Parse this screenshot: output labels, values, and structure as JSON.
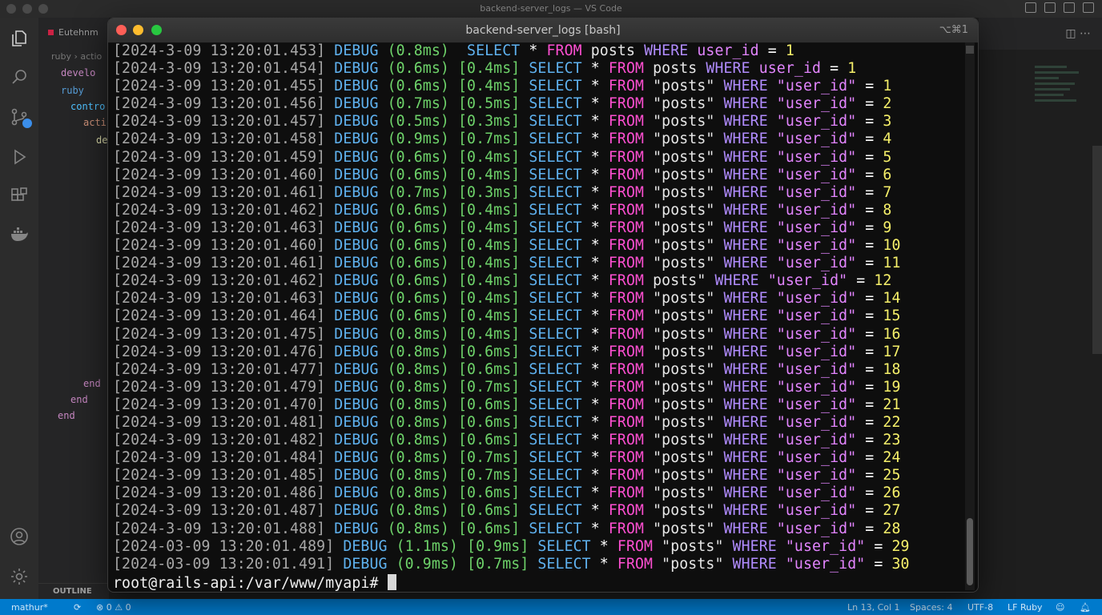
{
  "vscode": {
    "window_title": "backend-server_logs — VS Code",
    "editor_tab": "Eutehnm",
    "breadcrumb": "ruby › actio",
    "code_lines": [
      {
        "text": "develo",
        "color": "#c586c0"
      },
      {
        "text": "ruby",
        "color": "#569cd6"
      },
      {
        "text": "contro",
        "color": "#4fc1ff"
      },
      {
        "text": "acti",
        "color": "#ce9178"
      },
      {
        "text": "def",
        "color": "#dcdcaa"
      },
      {
        "text": "end",
        "color": "#c586c0"
      },
      {
        "text": "end",
        "color": "#c586c0"
      },
      {
        "text": "end",
        "color": "#c586c0"
      }
    ],
    "outline_label": "OUTLINE",
    "status": {
      "branch": "mathur*",
      "errors": "⊗ 0 ⚠ 0",
      "position": "Ln 13, Col 1",
      "spaces": "Spaces: 4",
      "encoding": "UTF-8",
      "language": "LF Ruby"
    }
  },
  "terminal": {
    "title": "backend-server_logs [bash]",
    "shortcut": "⌥⌘1",
    "prompt": "root@rails-api:/var/www/myapi#",
    "colors": {
      "timestamp": "#a8a8a8",
      "debug": "#5fb2f0",
      "duration": "#6ed36a",
      "from": "#ff4fd2",
      "where": "#b18cff",
      "number": "#f6f06a"
    },
    "lines": [
      {
        "ts": "[2024-3-09 13:20:01.453]",
        "lvl": "DEBUG",
        "dur": "(0.8ms) ",
        "sel": " SELECT",
        "op": " * ",
        "from": "FROM",
        "tbl": " posts ",
        "where": "WHERE",
        "col": " user_id",
        "eq": " = ",
        "val": "1"
      },
      {
        "ts": "[2024-3-09 13:20:01.454]",
        "lvl": "DEBUG",
        "dur": "(0.6ms) [0.4ms]",
        "sel": " SELECT",
        "op": " * ",
        "from": "FROM",
        "tbl": " posts ",
        "where": "WHERE",
        "col": " user_id",
        "eq": " = ",
        "val": "1"
      },
      {
        "ts": "[2024-3-09 13:20:01.455]",
        "lvl": "DEBUG",
        "dur": "(0.6ms) [0.4ms]",
        "sel": " SELECT",
        "op": " * ",
        "from": "FROM",
        "tbl": " \"posts\" ",
        "where": "WHERE",
        "col": " \"user_id\"",
        "eq": " = ",
        "val": "1"
      },
      {
        "ts": "[2024-3-09 13:20:01.456]",
        "lvl": "DEBUG",
        "dur": "(0.7ms) [0.5ms]",
        "sel": " SELECT",
        "op": " * ",
        "from": "FROM",
        "tbl": " \"posts\" ",
        "where": "WHERE",
        "col": " \"user_id\"",
        "eq": " = ",
        "val": "2"
      },
      {
        "ts": "[2024-3-09 13:20:01.457]",
        "lvl": "DEBUG",
        "dur": "(0.5ms) [0.3ms]",
        "sel": " SELECT",
        "op": " * ",
        "from": "FROM",
        "tbl": " \"posts\" ",
        "where": "WHERE",
        "col": " \"user_id\"",
        "eq": " = ",
        "val": "3"
      },
      {
        "ts": "[2024-3-09 13:20:01.458]",
        "lvl": "DEBUG",
        "dur": "(0.9ms) [0.7ms]",
        "sel": " SELECT",
        "op": " * ",
        "from": "FROM",
        "tbl": " \"posts\" ",
        "where": "WHERE",
        "col": " \"user_id\"",
        "eq": " = ",
        "val": "4"
      },
      {
        "ts": "[2024-3-09 13:20:01.459]",
        "lvl": "DEBUG",
        "dur": "(0.6ms) [0.4ms]",
        "sel": " SELECT",
        "op": " * ",
        "from": "FROM",
        "tbl": " \"posts\" ",
        "where": "WHERE",
        "col": " \"user_id\"",
        "eq": " = ",
        "val": "5"
      },
      {
        "ts": "[2024-3-09 13:20:01.460]",
        "lvl": "DEBUG",
        "dur": "(0.6ms) [0.4ms]",
        "sel": " SELECT",
        "op": " * ",
        "from": "FROM",
        "tbl": " \"posts\" ",
        "where": "WHERE",
        "col": " \"user_id\"",
        "eq": " = ",
        "val": "6"
      },
      {
        "ts": "[2024-3-09 13:20:01.461]",
        "lvl": "DEBUG",
        "dur": "(0.7ms) [0.3ms]",
        "sel": " SELECT",
        "op": " * ",
        "from": "FROM",
        "tbl": " \"posts\" ",
        "where": "WHERE",
        "col": " \"user_id\"",
        "eq": " = ",
        "val": "7"
      },
      {
        "ts": "[2024-3-09 13:20:01.462]",
        "lvl": "DEBUG",
        "dur": "(0.6ms) [0.4ms]",
        "sel": " SELECT",
        "op": " * ",
        "from": "FROM",
        "tbl": " \"posts\" ",
        "where": "WHERE",
        "col": " \"user_id\"",
        "eq": " = ",
        "val": "8"
      },
      {
        "ts": "[2024-3-09 13:20:01.463]",
        "lvl": "DEBUG",
        "dur": "(0.6ms) [0.4ms]",
        "sel": " SELECT",
        "op": " * ",
        "from": "FROM",
        "tbl": " \"posts\" ",
        "where": "WHERE",
        "col": " \"user_id\"",
        "eq": " = ",
        "val": "9"
      },
      {
        "ts": "[2024-3-09 13:20:01.460]",
        "lvl": "DEBUG",
        "dur": "(0.6ms) [0.4ms]",
        "sel": " SELECT",
        "op": " * ",
        "from": "FROM",
        "tbl": " \"posts\" ",
        "where": "WHERE",
        "col": " \"user_id\"",
        "eq": " = ",
        "val": "10"
      },
      {
        "ts": "[2024-3-09 13:20:01.461]",
        "lvl": "DEBUG",
        "dur": "(0.6ms) [0.4ms]",
        "sel": " SELECT",
        "op": " * ",
        "from": "FROM",
        "tbl": " \"posts\" ",
        "where": "WHERE",
        "col": " \"user_id\"",
        "eq": " = ",
        "val": "11"
      },
      {
        "ts": "[2024-3-09 13:20:01.462]",
        "lvl": "DEBUG",
        "dur": "(0.6ms) [0.4ms]",
        "sel": " SELECT",
        "op": " * ",
        "from": "FROM",
        "tbl": " posts\" ",
        "where": "WHERE",
        "col": " \"user_id\"",
        "eq": " = ",
        "val": "12"
      },
      {
        "ts": "[2024-3-09 13:20:01.463]",
        "lvl": "DEBUG",
        "dur": "(0.6ms) [0.4ms]",
        "sel": " SELECT",
        "op": " * ",
        "from": "FROM",
        "tbl": " \"posts\" ",
        "where": "WHERE",
        "col": " \"user_id\"",
        "eq": " = ",
        "val": "14"
      },
      {
        "ts": "[2024-3-09 13:20:01.464]",
        "lvl": "DEBUG",
        "dur": "(0.6ms) [0.4ms]",
        "sel": " SELECT",
        "op": " * ",
        "from": "FROM",
        "tbl": " \"posts\" ",
        "where": "WHERE",
        "col": " \"user_id\"",
        "eq": " = ",
        "val": "15"
      },
      {
        "ts": "[2024-3-09 13:20:01.475]",
        "lvl": "DEBUG",
        "dur": "(0.8ms) [0.4ms]",
        "sel": " SELECT",
        "op": " * ",
        "from": "FROM",
        "tbl": " \"posts\" ",
        "where": "WHERE",
        "col": " \"user_id\"",
        "eq": " = ",
        "val": "16"
      },
      {
        "ts": "[2024-3-09 13:20:01.476]",
        "lvl": "DEBUG",
        "dur": "(0.8ms) [0.6ms]",
        "sel": " SELECT",
        "op": " * ",
        "from": "FROM",
        "tbl": " \"posts\" ",
        "where": "WHERE",
        "col": " \"user_id\"",
        "eq": " = ",
        "val": "17"
      },
      {
        "ts": "[2024-3-09 13:20:01.477]",
        "lvl": "DEBUG",
        "dur": "(0.8ms) [0.6ms]",
        "sel": " SELECT",
        "op": " * ",
        "from": "FROM",
        "tbl": " \"posts\" ",
        "where": "WHERE",
        "col": " \"user_id\"",
        "eq": " = ",
        "val": "18"
      },
      {
        "ts": "[2024-3-09 13:20:01.479]",
        "lvl": "DEBUG",
        "dur": "(0.8ms) [0.7ms]",
        "sel": " SELECT",
        "op": " * ",
        "from": "FROM",
        "tbl": " \"posts\" ",
        "where": "WHERE",
        "col": " \"user_id\"",
        "eq": " = ",
        "val": "19"
      },
      {
        "ts": "[2024-3-09 13:20:01.470]",
        "lvl": "DEBUG",
        "dur": "(0.8ms) [0.6ms]",
        "sel": " SELECT",
        "op": " * ",
        "from": "FROM",
        "tbl": " \"posts\" ",
        "where": "WHERE",
        "col": " \"user_id\"",
        "eq": " = ",
        "val": "21"
      },
      {
        "ts": "[2024-3-09 13:20:01.481]",
        "lvl": "DEBUG",
        "dur": "(0.8ms) [0.6ms]",
        "sel": " SELECT",
        "op": " * ",
        "from": "FROM",
        "tbl": " \"posts\" ",
        "where": "WHERE",
        "col": " \"user_id\"",
        "eq": " = ",
        "val": "22"
      },
      {
        "ts": "[2024-3-09 13:20:01.482]",
        "lvl": "DEBUG",
        "dur": "(0.8ms) [0.6ms]",
        "sel": " SELECT",
        "op": " * ",
        "from": "FROM",
        "tbl": " \"posts\" ",
        "where": "WHERE",
        "col": " \"user_id\"",
        "eq": " = ",
        "val": "23"
      },
      {
        "ts": "[2024-3-09 13:20:01.484]",
        "lvl": "DEBUG",
        "dur": "(0.8ms) [0.7ms]",
        "sel": " SELECT",
        "op": " * ",
        "from": "FROM",
        "tbl": " \"posts\" ",
        "where": "WHERE",
        "col": " \"user_id\"",
        "eq": " = ",
        "val": "24"
      },
      {
        "ts": "[2024-3-09 13:20:01.485]",
        "lvl": "DEBUG",
        "dur": "(0.8ms) [0.7ms]",
        "sel": " SELECT",
        "op": " * ",
        "from": "FROM",
        "tbl": " \"posts\" ",
        "where": "WHERE",
        "col": " \"user_id\"",
        "eq": " = ",
        "val": "25"
      },
      {
        "ts": "[2024-3-09 13:20:01.486]",
        "lvl": "DEBUG",
        "dur": "(0.8ms) [0.6ms]",
        "sel": " SELECT",
        "op": " * ",
        "from": "FROM",
        "tbl": " \"posts\" ",
        "where": "WHERE",
        "col": " \"user_id\"",
        "eq": " = ",
        "val": "26"
      },
      {
        "ts": "[2024-3-09 13:20:01.487]",
        "lvl": "DEBUG",
        "dur": "(0.8ms) [0.6ms]",
        "sel": " SELECT",
        "op": " * ",
        "from": "FROM",
        "tbl": " \"posts\" ",
        "where": "WHERE",
        "col": " \"user_id\"",
        "eq": " = ",
        "val": "27"
      },
      {
        "ts": "[2024-3-09 13:20:01.488]",
        "lvl": "DEBUG",
        "dur": "(0.8ms) [0.6ms]",
        "sel": " SELECT",
        "op": " * ",
        "from": "FROM",
        "tbl": " \"posts\" ",
        "where": "WHERE",
        "col": " \"user_id\"",
        "eq": " = ",
        "val": "28"
      },
      {
        "ts": "[2024-03-09 13:20:01.489]",
        "lvl": "DEBUG",
        "dur": "(1.1ms) [0.9ms]",
        "sel": " SELECT",
        "op": " * ",
        "from": "FROM",
        "tbl": " \"posts\" ",
        "where": "WHERE",
        "col": " \"user_id\"",
        "eq": " = ",
        "val": "29"
      },
      {
        "ts": "[2024-03-09 13:20:01.491]",
        "lvl": "DEBUG",
        "dur": "(0.9ms) [0.7ms]",
        "sel": " SELECT",
        "op": " * ",
        "from": "FROM",
        "tbl": " \"posts\" ",
        "where": "WHERE",
        "col": " \"user_id\"",
        "eq": " = ",
        "val": "30"
      }
    ]
  }
}
